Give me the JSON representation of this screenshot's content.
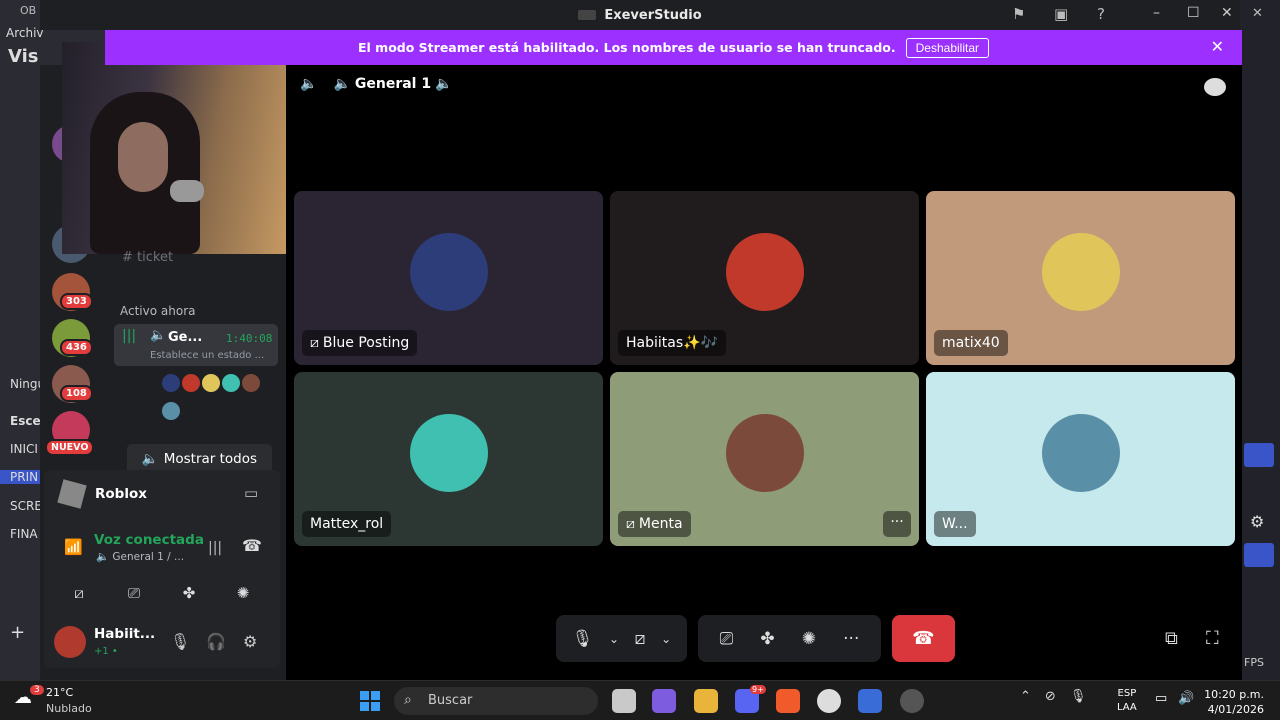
{
  "obs": {
    "title": "OB",
    "menu": "Archiv",
    "vis": "Vis",
    "side": [
      "Ningu",
      "Escen",
      "INICI",
      "PRIN",
      "SCRE",
      "FINA"
    ],
    "fps": "FPS"
  },
  "window": {
    "title": "ExeverStudio"
  },
  "banner": {
    "text": "El modo Streamer está habilitado. Los nombres de usuario se han truncado.",
    "button": "Deshabilitar"
  },
  "channel": {
    "name": "General 1"
  },
  "tiles": [
    {
      "name": "Blue Posting",
      "muted": true,
      "bg": "#2b2533",
      "av": "#2d3d7a"
    },
    {
      "name": "Habiitas✨🎶",
      "muted": false,
      "bg": "#201b1d",
      "av": "#c0392b"
    },
    {
      "name": "matix40",
      "muted": false,
      "bg": "#c19a7c",
      "av": "#e0c65a"
    },
    {
      "name": "Mattex_rol",
      "muted": false,
      "bg": "#2c3734",
      "av": "#3fc0b0"
    },
    {
      "name": "Menta",
      "muted": true,
      "bg": "#8e9c78",
      "av": "#7b4a3a"
    },
    {
      "name": "W...",
      "muted": false,
      "bg": "#c6e9ed",
      "av": "#5a8fa8"
    }
  ],
  "sidebar": {
    "channel_ticket": "ticket",
    "active_label": "Activo ahora",
    "voice_name": "Ge...",
    "voice_time": "1:40:08",
    "voice_status": "Establece un estado ...",
    "show_all": "Mostrar todos",
    "badges": [
      "303",
      "436",
      "108",
      "NUEVO"
    ]
  },
  "activity": {
    "game": "Roblox"
  },
  "voice_panel": {
    "status": "Voz conectada",
    "channel": "General 1 / ..."
  },
  "user": {
    "name": "Habiit...",
    "sub": "+1 • "
  },
  "taskbar": {
    "temp": "21°C",
    "weather": "Nublado",
    "search": "Buscar",
    "lang1": "ESP",
    "lang2": "LAA",
    "time": "10:20 p.m.",
    "date": "4/01/2026",
    "notif": "3",
    "discord_badge": "9+"
  }
}
